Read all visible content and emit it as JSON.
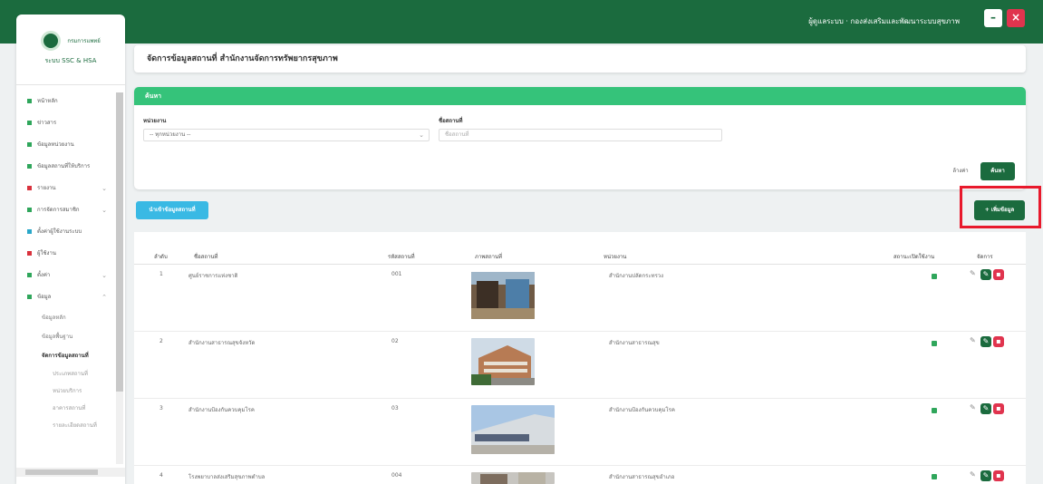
{
  "topbar": {
    "user_text": "ผู้ดูแลระบบ · กองส่งเสริมและพัฒนาระบบสุขภาพ",
    "minimize_label": "–",
    "close_label": "×",
    "brand_color": "#1b6b3e"
  },
  "sidebar": {
    "logo_title": "กรมการแพทย์",
    "logo_subtitle": "ระบบ SSC & HSA",
    "items": [
      {
        "label": "หน้าหลัก"
      },
      {
        "label": "ข่าวสาร"
      },
      {
        "label": "ข้อมูลหน่วยงาน"
      },
      {
        "label": "ข้อมูลสถานที่ให้บริการ"
      },
      {
        "label": "รายงาน"
      },
      {
        "label": "การจัดการสมาชิก"
      },
      {
        "label": "ตั้งค่าผู้ใช้งานระบบ"
      },
      {
        "label": "ผู้ใช้งาน"
      },
      {
        "label": "ตั้งค่า"
      },
      {
        "label": "ข้อมูล"
      }
    ],
    "sub_items": [
      {
        "label": "ข้อมูลหลัก"
      },
      {
        "label": "ข้อมูลพื้นฐาน"
      },
      {
        "label": "จัดการข้อมูลสถานที่"
      }
    ],
    "sub_sub_items": [
      {
        "label": "ประเภทสถานที่"
      },
      {
        "label": "หน่วยบริการ"
      },
      {
        "label": "อาคารสถานที่"
      },
      {
        "label": "รายละเอียดสถานที่"
      }
    ]
  },
  "page": {
    "title": "จัดการข้อมูลสถานที่ สำนักงานจัดการทรัพยากรสุขภาพ"
  },
  "filter": {
    "header": "ค้นหา",
    "agency_label": "หน่วยงาน",
    "agency_value": "-- ทุกหน่วยงาน --",
    "place_label": "ชื่อสถานที่",
    "place_placeholder": "ชื่อสถานที่",
    "clear_label": "ล้างค่า",
    "search_label": "ค้นหา"
  },
  "toolbar": {
    "export_label": "นำเข้าข้อมูลสถานที่",
    "add_label": "+ เพิ่มข้อมูล"
  },
  "table": {
    "columns": [
      "ลำดับ",
      "ชื่อสถานที่",
      "รหัสสถานที่",
      "ภาพสถานที่",
      "หน่วยงาน",
      "สถานะเปิดใช้งาน",
      "จัดการ"
    ],
    "rows": [
      {
        "no": "1",
        "name": "ศูนย์ราชการแห่งชาติ",
        "code": "001",
        "agency": "สำนักงานปลัดกระทรวง"
      },
      {
        "no": "2",
        "name": "สำนักงานสาธารณสุขจังหวัด",
        "code": "02",
        "agency": "สำนักงานสาธารณสุข"
      },
      {
        "no": "3",
        "name": "สำนักงานป้องกันควบคุมโรค",
        "code": "03",
        "agency": "สำนักงานป้องกันควบคุมโรค"
      },
      {
        "no": "4",
        "name": "โรงพยาบาลส่งเสริมสุขภาพตำบล",
        "code": "004",
        "agency": "สำนักงานสาธารณสุขอำเภอ"
      }
    ]
  }
}
